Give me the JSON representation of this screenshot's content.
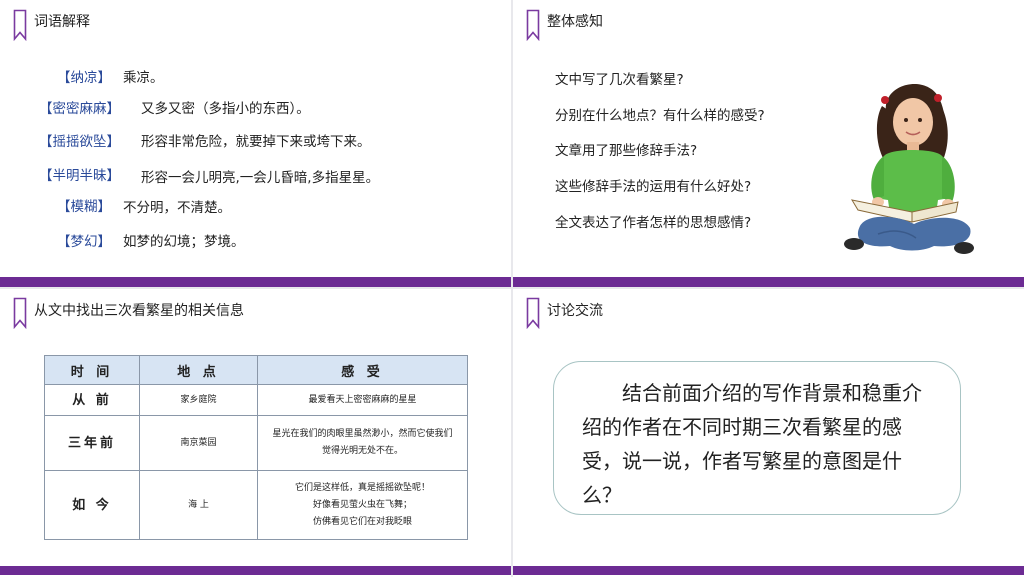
{
  "slide1": {
    "title": "词语解释",
    "entries": [
      {
        "term": "【纳凉】",
        "def": "乘凉。"
      },
      {
        "term": "【密密麻麻】",
        "def": "又多又密（多指小的东西）。"
      },
      {
        "term": "【摇摇欲坠】",
        "def": "形容非常危险，就要掉下来或垮下来。"
      },
      {
        "term": "【半明半昧】",
        "def": "形容一会儿明亮,一会儿昏暗,多指星星。"
      },
      {
        "term": "【模糊】",
        "def": "不分明，不清楚。"
      },
      {
        "term": "【梦幻】",
        "def": "如梦的幻境；梦境。"
      }
    ]
  },
  "slide2": {
    "title": "整体感知",
    "questions": [
      "文中写了几次看繁星?",
      "分别在什么地点？有什么样的感受?",
      "文章用了那些修辞手法?",
      "这些修辞手法的运用有什么好处?",
      "全文表达了作者怎样的思想感情?"
    ]
  },
  "slide3": {
    "title": "从文中找出三次看繁星的相关信息",
    "headers": [
      "时 间",
      "地 点",
      "感 受"
    ],
    "rows": [
      {
        "time": "从 前",
        "place": "家乡庭院",
        "feel": [
          "最爱看天上密密麻麻的星星"
        ]
      },
      {
        "time": "三年前",
        "place": "南京菜园",
        "feel": [
          "星光在我们的肉眼里虽然渺小，然而它使我们",
          "觉得光明无处不在。"
        ]
      },
      {
        "time": "如 今",
        "place": "海 上",
        "feel": [
          "它们是这样低，真是摇摇欲坠呢！",
          "好像看见萤火虫在飞舞；",
          "仿佛看见它们在对我眨眼"
        ]
      }
    ]
  },
  "slide4": {
    "title": "讨论交流",
    "text": "结合前面介绍的写作背景和稳重介绍的作者在不同时期三次看繁星的感受，说一说，作者写繁星的意图是什么？"
  },
  "colors": {
    "accent": "#6c2b93",
    "term": "#2a4a9a",
    "table_header": "#d7e4f3"
  }
}
